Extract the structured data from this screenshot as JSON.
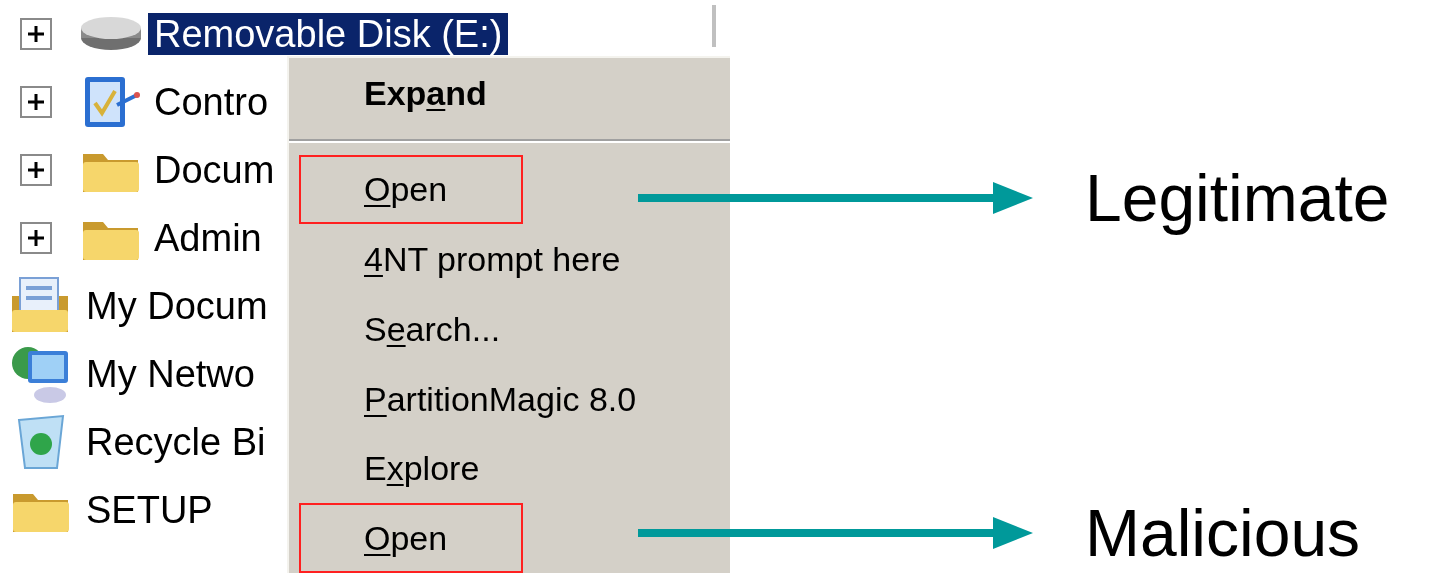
{
  "tree": {
    "items": [
      {
        "label": "Removable Disk (E:)",
        "kind": "drive",
        "expandable": true,
        "selected": true
      },
      {
        "label": "Contro",
        "kind": "control-panel",
        "expandable": true,
        "selected": false
      },
      {
        "label": "Docum",
        "kind": "folder",
        "expandable": true,
        "selected": false
      },
      {
        "label": "Admin",
        "kind": "folder",
        "expandable": true,
        "selected": false
      },
      {
        "label": "My Docum",
        "kind": "documents",
        "expandable": false,
        "selected": false
      },
      {
        "label": "My Netwo",
        "kind": "network",
        "expandable": false,
        "selected": false
      },
      {
        "label": "Recycle Bi",
        "kind": "recycle",
        "expandable": false,
        "selected": false
      },
      {
        "label": "SETUP",
        "kind": "folder",
        "expandable": false,
        "selected": false
      }
    ]
  },
  "context_menu": {
    "items": [
      {
        "kind": "command",
        "default": true,
        "highlighted": false,
        "label": [
          {
            "text": "Exp",
            "accel": false
          },
          {
            "text": "a",
            "accel": true
          },
          {
            "text": "nd",
            "accel": false
          }
        ]
      },
      {
        "kind": "separator"
      },
      {
        "kind": "command",
        "default": false,
        "highlighted": true,
        "label": [
          {
            "text": "O",
            "accel": true
          },
          {
            "text": "pen",
            "accel": false
          }
        ]
      },
      {
        "kind": "command",
        "default": false,
        "highlighted": false,
        "label": [
          {
            "text": "4",
            "accel": true
          },
          {
            "text": "NT prompt here",
            "accel": false
          }
        ]
      },
      {
        "kind": "command",
        "default": false,
        "highlighted": false,
        "label": [
          {
            "text": "S",
            "accel": false
          },
          {
            "text": "e",
            "accel": true
          },
          {
            "text": "arch...",
            "accel": false
          }
        ]
      },
      {
        "kind": "command",
        "default": false,
        "highlighted": false,
        "label": [
          {
            "text": "P",
            "accel": true
          },
          {
            "text": "artitionMagic 8.0",
            "accel": false
          }
        ]
      },
      {
        "kind": "command",
        "default": false,
        "highlighted": false,
        "label": [
          {
            "text": "E",
            "accel": false
          },
          {
            "text": "x",
            "accel": true
          },
          {
            "text": "plore",
            "accel": false
          }
        ]
      },
      {
        "kind": "command",
        "default": false,
        "highlighted": true,
        "label": [
          {
            "text": "O",
            "accel": true
          },
          {
            "text": "pen",
            "accel": false
          }
        ]
      }
    ]
  },
  "annotations": [
    {
      "label": "Legitimate"
    },
    {
      "label": "Malicious"
    }
  ]
}
